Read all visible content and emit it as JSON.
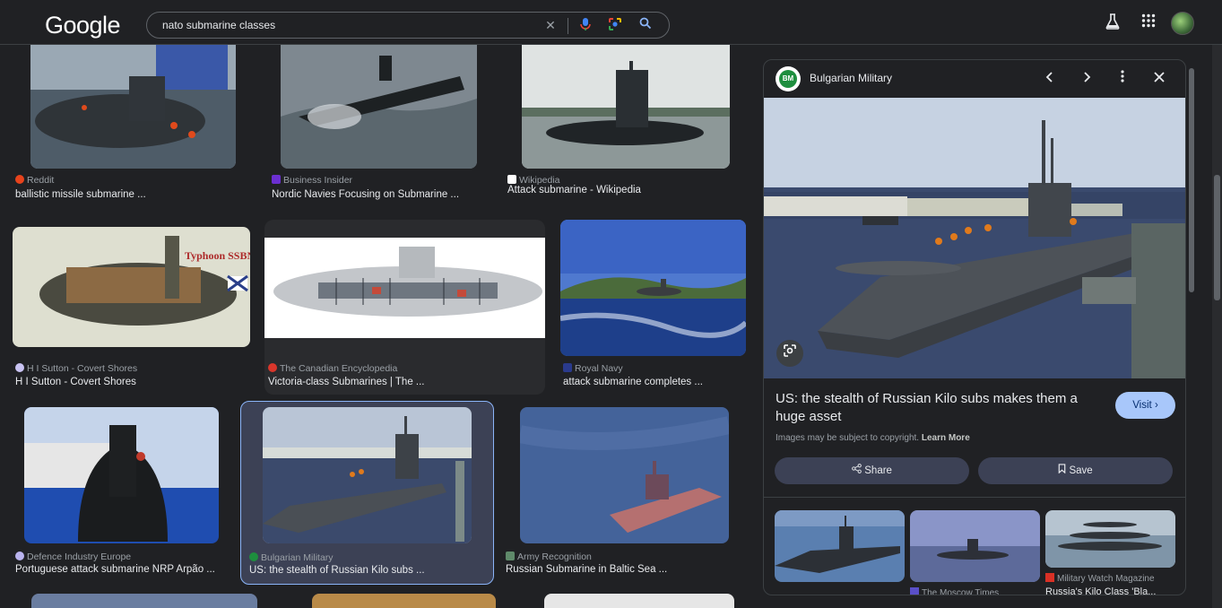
{
  "app": {
    "logo": "Google"
  },
  "search": {
    "query": "nato submarine classes"
  },
  "results": [
    {
      "source": "Reddit",
      "title": "ballistic missile submarine ...",
      "fav_color": "#e8431c"
    },
    {
      "source": "Business Insider",
      "title": "Nordic Navies Focusing on Submarine ...",
      "fav_color": "#6b2fd1"
    },
    {
      "source": "Wikipedia",
      "title": "Attack submarine - Wikipedia",
      "fav_color": "#ffffff"
    },
    {
      "source": "H I Sutton - Covert Shores",
      "title": "H I Sutton - Covert Shores",
      "fav_color": "#c9c3f3"
    },
    {
      "source": "The Canadian Encyclopedia",
      "title": "Victoria-class Submarines | The ...",
      "fav_color": "#d9362b"
    },
    {
      "source": "Royal Navy",
      "title": "attack submarine completes ...",
      "fav_color": "#2a3a8c"
    },
    {
      "source": "Defence Industry Europe",
      "title": "Portuguese attack submarine NRP Arpão ...",
      "fav_color": "#b9b3ee"
    },
    {
      "source": "Bulgarian Military",
      "title": "US: the stealth of Russian Kilo subs ...",
      "fav_color": "#1e8e3e"
    },
    {
      "source": "Army Recognition",
      "title": "Russian Submarine in Baltic Sea ...",
      "fav_color": "#5f8a6a"
    }
  ],
  "panel": {
    "source": "Bulgarian Military",
    "badge": "BM",
    "title": "US: the stealth of Russian Kilo subs makes them a huge asset",
    "visit": "Visit",
    "copyright": "Images may be subject to copyright.",
    "learn_more": "Learn More",
    "share": "Share",
    "save": "Save",
    "related": [
      {
        "source": "The Moscow Times",
        "title": "",
        "fav_color": "#5a4fc9"
      },
      {
        "source": "Military Watch Magazine",
        "title": "Russia's Kilo Class 'Bla...",
        "fav_color": "#d93025"
      }
    ]
  },
  "colors": {
    "accent": "#8ab4f8",
    "visit_bg": "#a8c7fa"
  }
}
